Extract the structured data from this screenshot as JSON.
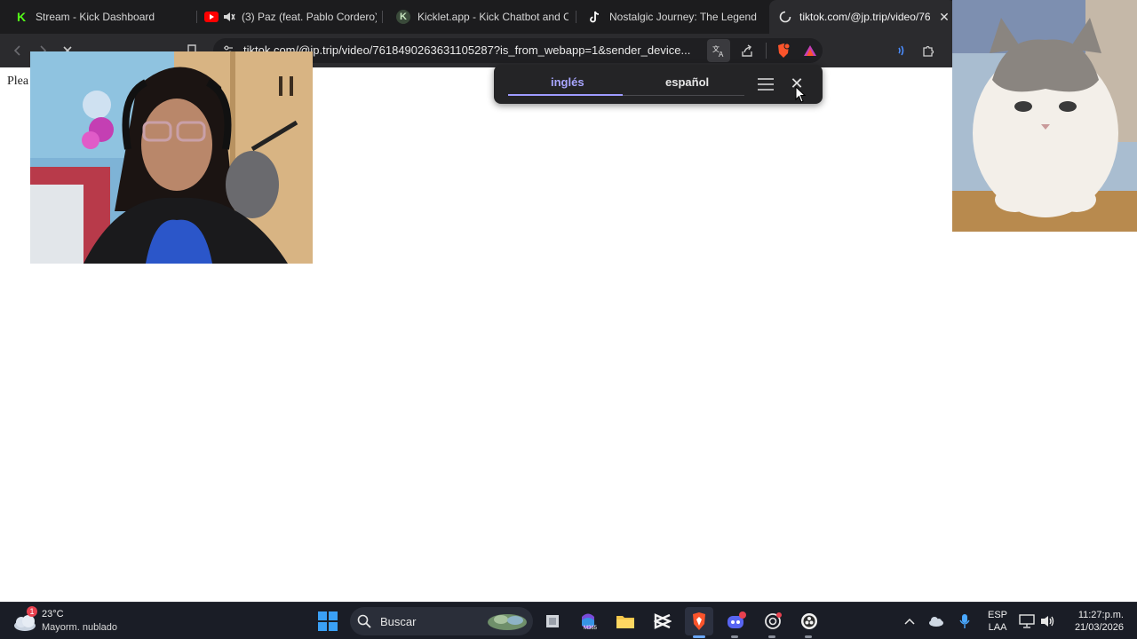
{
  "browser": {
    "tabs": [
      {
        "title": "Stream - Kick Dashboard",
        "favicon": "kick-icon",
        "active": false
      },
      {
        "title": "(3) Paz (feat. Pablo Cordero) -",
        "favicon": "youtube-icon",
        "active": false,
        "muted": true
      },
      {
        "title": "Kicklet.app - Kick Chatbot and Ov",
        "favicon": "kicklet-icon",
        "active": false
      },
      {
        "title": "Nostalgic Journey: The Legend of",
        "favicon": "tiktok-icon",
        "active": false
      },
      {
        "title": "tiktok.com/@jp.trip/video/76",
        "favicon": "loading-spinner-icon",
        "active": true
      }
    ],
    "url": "tiktok.com/@jp.trip/video/7618490263631105287?is_from_webapp=1&sender_device...",
    "accent_color": "#9e9bff"
  },
  "page": {
    "text": "Plea"
  },
  "translate_popup": {
    "source_language": "inglés",
    "target_language": "español"
  },
  "taskbar": {
    "weather": {
      "temp": "23°C",
      "description": "Mayorm. nublado",
      "badge": "1"
    },
    "search_label": "Buscar",
    "lang_line1": "ESP",
    "lang_line2": "LAA",
    "time": "11:27:p.m.",
    "date": "21/03/2026"
  }
}
